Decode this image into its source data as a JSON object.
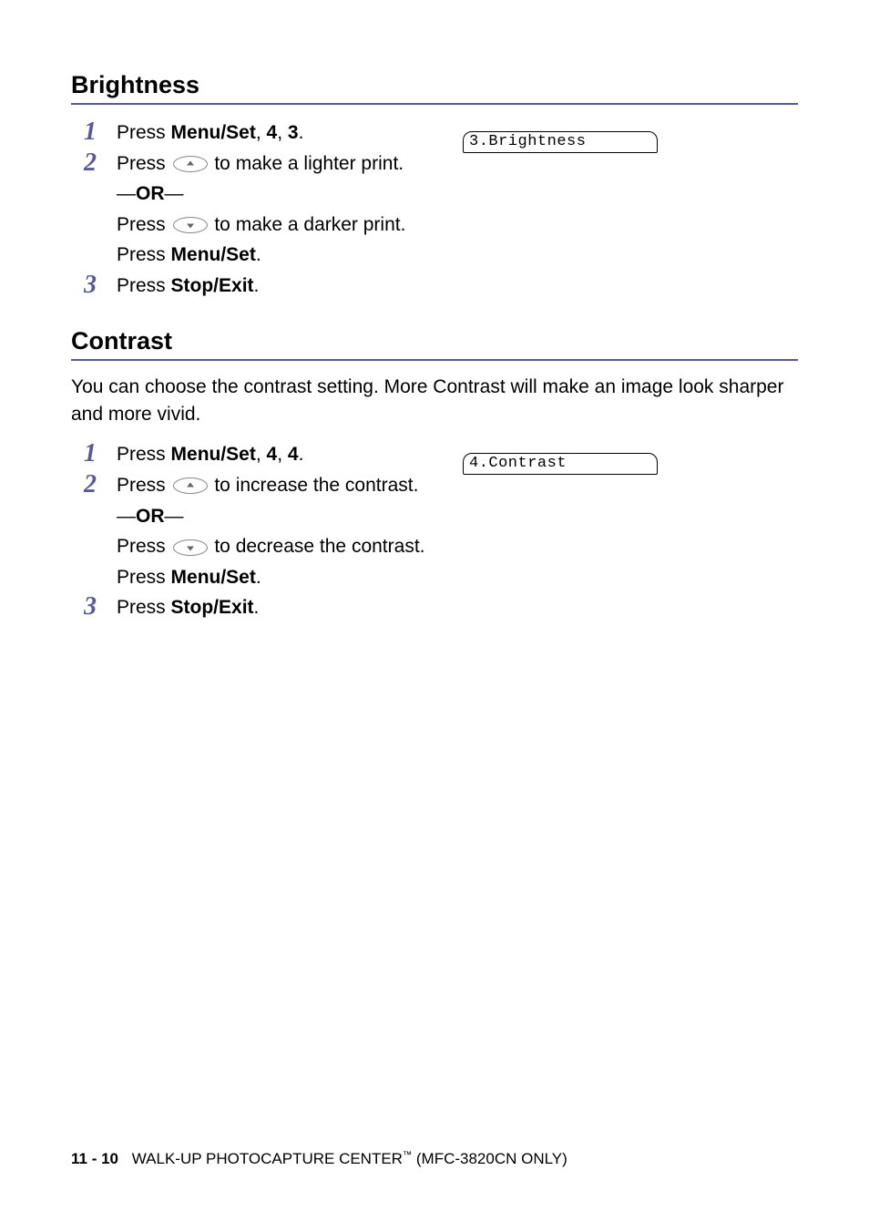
{
  "sections": {
    "brightness": {
      "heading": "Brightness",
      "lcd": "3.Brightness",
      "step1_a": "Press ",
      "step1_b": "Menu/Set",
      "step1_c": ", ",
      "step1_d": "4",
      "step1_e": ", ",
      "step1_f": "3",
      "step1_g": ".",
      "step2_a": "Press ",
      "step2_b": " to make a lighter print.",
      "step2_or1": "—",
      "step2_or2": "OR",
      "step2_or3": "—",
      "step2_c": "Press ",
      "step2_d": " to make a darker print.",
      "step2_e": "Press ",
      "step2_f": "Menu/Set",
      "step2_g": ".",
      "step3_a": "Press ",
      "step3_b": "Stop/Exit",
      "step3_c": "."
    },
    "contrast": {
      "heading": "Contrast",
      "intro": "You can choose the contrast setting. More Contrast will make an image look sharper and more vivid.",
      "lcd": "4.Contrast",
      "step1_a": "Press ",
      "step1_b": "Menu/Set",
      "step1_c": ", ",
      "step1_d": "4",
      "step1_e": ", ",
      "step1_f": "4",
      "step1_g": ".",
      "step2_a": "Press ",
      "step2_b": " to increase the contrast.",
      "step2_or1": "—",
      "step2_or2": "OR",
      "step2_or3": "—",
      "step2_c": "Press ",
      "step2_d": " to decrease the contrast.",
      "step2_e": "Press ",
      "step2_f": "Menu/Set",
      "step2_g": ".",
      "step3_a": "Press ",
      "step3_b": "Stop/Exit",
      "step3_c": "."
    }
  },
  "footer": {
    "pageno": "11 - 10",
    "title_a": "WALK-UP PHOTOCAPTURE CENTER",
    "title_tm": "™",
    "title_b": " (MFC-3820CN ONLY)"
  }
}
